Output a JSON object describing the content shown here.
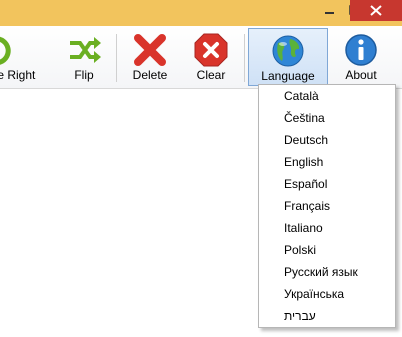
{
  "colors": {
    "titlebar": "#f2c45d",
    "close_button": "#c7372f",
    "toolbar_bg": "#f4f5f7",
    "highlight": "#cfe1f6",
    "flip_green": "#6aaf22",
    "delete_red": "#d9342b",
    "clear_red": "#d9342b",
    "about_blue": "#2f7fd1"
  },
  "window": {
    "minimize_icon": "minimize-icon",
    "maximize_icon": "maximize-icon",
    "close_icon": "close-icon"
  },
  "toolbar": {
    "rotate_right": {
      "label": "te Right",
      "icon": "rotate-right-icon"
    },
    "flip": {
      "label": "Flip",
      "icon": "flip-icon"
    },
    "delete": {
      "label": "Delete",
      "icon": "delete-icon"
    },
    "clear": {
      "label": "Clear",
      "icon": "clear-icon"
    },
    "language": {
      "label": "Language",
      "icon": "globe-icon"
    },
    "about": {
      "label": "About",
      "icon": "info-icon"
    }
  },
  "language_menu": {
    "items": [
      "Català",
      "Čeština",
      "Deutsch",
      "English",
      "Español",
      "Français",
      "Italiano",
      "Polski",
      "Русский язык",
      "Українська",
      "עברית"
    ]
  }
}
